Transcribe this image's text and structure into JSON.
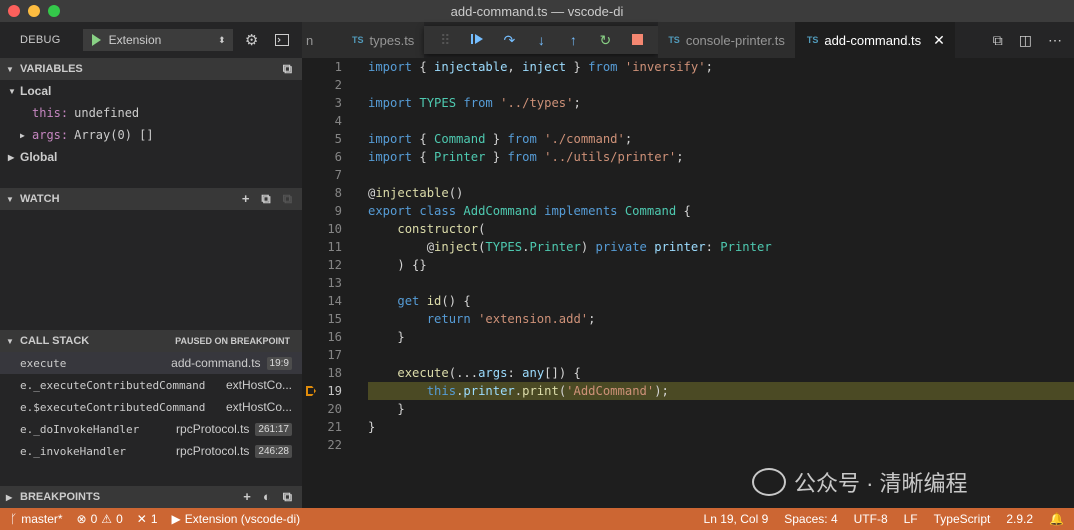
{
  "window": {
    "title": "add-command.ts — vscode-di"
  },
  "debug": {
    "label": "DEBUG",
    "launch_config": "Extension",
    "toolbar_icons": [
      "continue-icon",
      "step-over-icon",
      "step-into-icon",
      "step-out-icon",
      "restart-icon",
      "stop-icon"
    ]
  },
  "variables": {
    "header": "VARIABLES",
    "local_label": "Local",
    "this_name": "this:",
    "this_value": "undefined",
    "args_name": "args:",
    "args_value": "Array(0) []",
    "global_label": "Global"
  },
  "watch": {
    "header": "WATCH"
  },
  "call_stack": {
    "header": "CALL STACK",
    "status": "PAUSED ON BREAKPOINT",
    "frames": [
      {
        "fn": "execute",
        "file": "add-command.ts",
        "line": "19:9"
      },
      {
        "fn": "e._executeContributedCommand",
        "file": "extHostCo...",
        "line": ""
      },
      {
        "fn": "e.$executeContributedCommand",
        "file": "extHostCo...",
        "line": ""
      },
      {
        "fn": "e._doInvokeHandler",
        "file": "rpcProtocol.ts",
        "line": "261:17"
      },
      {
        "fn": "e._invokeHandler",
        "file": "rpcProtocol.ts",
        "line": "246:28"
      }
    ]
  },
  "breakpoints": {
    "header": "BREAKPOINTS"
  },
  "tabs": [
    {
      "label": "n",
      "active": false
    },
    {
      "label": "types.ts",
      "active": false
    },
    {
      "label": "console-printer.ts",
      "active": false
    },
    {
      "label": "add-command.ts",
      "active": true
    }
  ],
  "tab_badge": "TS",
  "editor": {
    "current_line": 19,
    "lines": [
      "import { injectable, inject } from 'inversify';",
      "",
      "import TYPES from '../types';",
      "",
      "import { Command } from './command';",
      "import { Printer } from '../utils/printer';",
      "",
      "@injectable()",
      "export class AddCommand implements Command {",
      "    constructor(",
      "        @inject(TYPES.Printer) private printer: Printer",
      "    ) {}",
      "",
      "    get id() {",
      "        return 'extension.add';",
      "    }",
      "",
      "    execute(...args: any[]) {",
      "        this.printer.print('AddCommand');",
      "    }",
      "}",
      ""
    ]
  },
  "status": {
    "branch": "master*",
    "errors": "0",
    "warnings": "0",
    "tools": "1",
    "launch": "Extension (vscode-di)",
    "position": "Ln 19, Col 9",
    "spaces": "Spaces: 4",
    "encoding": "UTF-8",
    "eol": "LF",
    "language": "TypeScript",
    "version": "2.9.2"
  },
  "watermark": "公众号 · 清晰编程",
  "colors": {
    "statusbar": "#cc6633",
    "accent": "#519aba",
    "breakpoint_line": "#4b4a24"
  }
}
